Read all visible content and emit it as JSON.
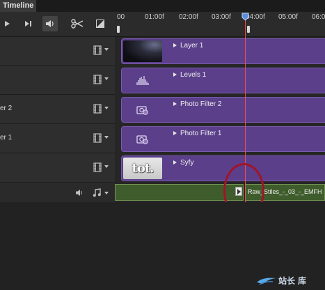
{
  "panel": {
    "tab_label": "Timeline"
  },
  "ruler": {
    "ticks": [
      "00",
      "01:00f",
      "02:00f",
      "03:00f",
      "04:00f",
      "05:00f",
      "06:00"
    ]
  },
  "tracks": [
    {
      "panel_label": "",
      "clip_label": "Layer 1"
    },
    {
      "panel_label": "",
      "clip_label": "Levels 1"
    },
    {
      "panel_label": "er 2",
      "clip_label": "Photo Filter 2"
    },
    {
      "panel_label": "er 1",
      "clip_label": "Photo Filter 1"
    },
    {
      "panel_label": "",
      "clip_label": "Syfy",
      "thumb_text": "tot."
    }
  ],
  "audio": {
    "clip_label": "Raw_Stiles_-_03_-_EMFH"
  },
  "watermark": {
    "text": "站长",
    "text2": "库"
  },
  "colors": {
    "adjust_clip": "#5b3f8a",
    "audio_clip": "#3f5d2c",
    "playhead": "#ff4a4a",
    "annotation": "#a0142a"
  }
}
